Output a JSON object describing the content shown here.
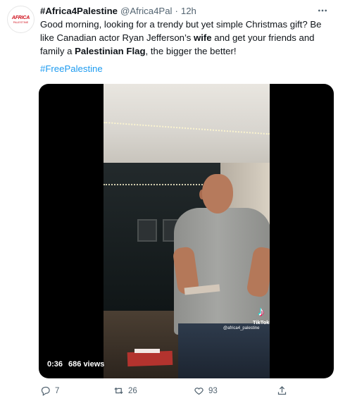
{
  "tweet": {
    "avatar_text_top": "AFRICA",
    "avatar_text_bottom": "PALESTINE",
    "display_name": "#Africa4Palestine",
    "handle": "@Africa4Pal",
    "separator": "·",
    "timestamp": "12h",
    "more_icon": "more-dots-icon",
    "text": {
      "part1": "Good morning, looking for a trendy but yet simple Christmas gift? Be like Canadian actor Ryan Jefferson’s ",
      "bold1": "wife",
      "part2": " and get your friends and family a ",
      "bold2": "Palestinian Flag",
      "part3": ", the bigger the better!"
    },
    "hashtag": "#FreePalestine"
  },
  "video": {
    "duration": "0:36",
    "views": "686 views",
    "tiktok_label": "TikTok",
    "tiktok_user": "@africa4_palestine"
  },
  "actions": {
    "replies": "7",
    "retweets": "26",
    "likes": "93",
    "reply_icon": "reply-icon",
    "retweet_icon": "retweet-icon",
    "like_icon": "heart-icon",
    "share_icon": "share-icon"
  },
  "colors": {
    "link": "#1d9bf0",
    "secondary_text": "#536471",
    "primary_text": "#0f1419"
  }
}
